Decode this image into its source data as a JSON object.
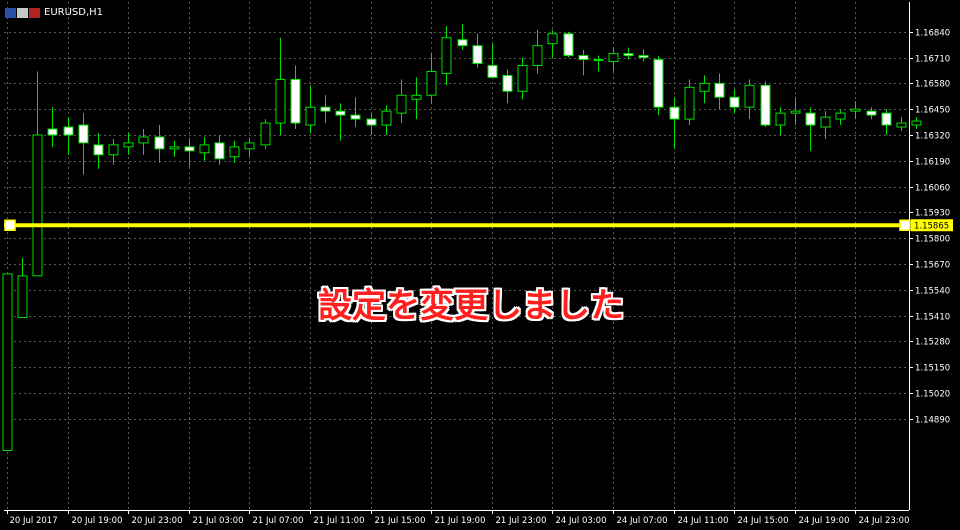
{
  "window": {
    "symbol_label": "EURUSD,H1"
  },
  "overlay_text": "設定を変更しました",
  "colors": {
    "background": "#000000",
    "grid": "#5a5a5a",
    "axis": "#ffffff",
    "bull_outline": "#00e000",
    "bear_fill": "#ffffff",
    "line": "#ffff00"
  },
  "chart_data": {
    "type": "candlestick",
    "symbol": "EURUSD",
    "timeframe": "H1",
    "ylim": [
      1.1443,
      1.1699
    ],
    "y_ticks": [
      "1.16840",
      "1.16710",
      "1.16580",
      "1.16450",
      "1.16320",
      "1.16190",
      "1.16060",
      "1.15930",
      "1.15800",
      "1.15670",
      "1.15540",
      "1.15410",
      "1.15280",
      "1.15150",
      "1.15020",
      "1.14890"
    ],
    "x_ticks": [
      "20 Jul 2017",
      "20 Jul 19:00",
      "20 Jul 23:00",
      "21 Jul 03:00",
      "21 Jul 07:00",
      "21 Jul 11:00",
      "21 Jul 15:00",
      "21 Jul 19:00",
      "21 Jul 23:00",
      "24 Jul 03:00",
      "24 Jul 07:00",
      "24 Jul 11:00",
      "24 Jul 15:00",
      "24 Jul 19:00",
      "24 Jul 23:00"
    ],
    "horizontal_line": {
      "price": 1.15865,
      "label": "1.15865"
    },
    "grid": true,
    "candles": [
      {
        "o": 1.1473,
        "h": 1.1562,
        "l": 1.1473,
        "c": 1.1562
      },
      {
        "o": 1.154,
        "h": 1.157,
        "l": 1.154,
        "c": 1.1561
      },
      {
        "o": 1.1561,
        "h": 1.1664,
        "l": 1.1561,
        "c": 1.1632
      },
      {
        "o": 1.1635,
        "h": 1.1646,
        "l": 1.1626,
        "c": 1.1632
      },
      {
        "o": 1.1636,
        "h": 1.1641,
        "l": 1.1622,
        "c": 1.1632
      },
      {
        "o": 1.1637,
        "h": 1.1643,
        "l": 1.1612,
        "c": 1.1628
      },
      {
        "o": 1.1627,
        "h": 1.1633,
        "l": 1.1615,
        "c": 1.1622
      },
      {
        "o": 1.1622,
        "h": 1.163,
        "l": 1.1617,
        "c": 1.1627
      },
      {
        "o": 1.1626,
        "h": 1.1633,
        "l": 1.1622,
        "c": 1.1628
      },
      {
        "o": 1.1628,
        "h": 1.1635,
        "l": 1.1622,
        "c": 1.1631
      },
      {
        "o": 1.1631,
        "h": 1.1637,
        "l": 1.1618,
        "c": 1.1625
      },
      {
        "o": 1.1625,
        "h": 1.1629,
        "l": 1.1621,
        "c": 1.1626
      },
      {
        "o": 1.1626,
        "h": 1.163,
        "l": 1.1616,
        "c": 1.1624
      },
      {
        "o": 1.1623,
        "h": 1.1631,
        "l": 1.1619,
        "c": 1.1627
      },
      {
        "o": 1.1628,
        "h": 1.1632,
        "l": 1.1617,
        "c": 1.162
      },
      {
        "o": 1.1621,
        "h": 1.1629,
        "l": 1.1618,
        "c": 1.1626
      },
      {
        "o": 1.1625,
        "h": 1.163,
        "l": 1.1621,
        "c": 1.1628
      },
      {
        "o": 1.1627,
        "h": 1.164,
        "l": 1.1625,
        "c": 1.1638
      },
      {
        "o": 1.1638,
        "h": 1.1681,
        "l": 1.1632,
        "c": 1.166
      },
      {
        "o": 1.166,
        "h": 1.1667,
        "l": 1.1635,
        "c": 1.1638
      },
      {
        "o": 1.1637,
        "h": 1.1657,
        "l": 1.1633,
        "c": 1.1646
      },
      {
        "o": 1.1646,
        "h": 1.1652,
        "l": 1.1638,
        "c": 1.1644
      },
      {
        "o": 1.1644,
        "h": 1.1648,
        "l": 1.1629,
        "c": 1.1642
      },
      {
        "o": 1.1642,
        "h": 1.1651,
        "l": 1.1636,
        "c": 1.164
      },
      {
        "o": 1.164,
        "h": 1.1643,
        "l": 1.1632,
        "c": 1.1637
      },
      {
        "o": 1.1637,
        "h": 1.1647,
        "l": 1.1632,
        "c": 1.1644
      },
      {
        "o": 1.1643,
        "h": 1.166,
        "l": 1.1638,
        "c": 1.1652
      },
      {
        "o": 1.165,
        "h": 1.1661,
        "l": 1.164,
        "c": 1.1652
      },
      {
        "o": 1.1652,
        "h": 1.1673,
        "l": 1.1648,
        "c": 1.1664
      },
      {
        "o": 1.1663,
        "h": 1.1687,
        "l": 1.1657,
        "c": 1.1681
      },
      {
        "o": 1.168,
        "h": 1.1688,
        "l": 1.1675,
        "c": 1.1677
      },
      {
        "o": 1.1677,
        "h": 1.1683,
        "l": 1.1666,
        "c": 1.1668
      },
      {
        "o": 1.1667,
        "h": 1.1678,
        "l": 1.1662,
        "c": 1.1661
      },
      {
        "o": 1.1662,
        "h": 1.1665,
        "l": 1.1648,
        "c": 1.1654
      },
      {
        "o": 1.1654,
        "h": 1.1671,
        "l": 1.165,
        "c": 1.1667
      },
      {
        "o": 1.1667,
        "h": 1.1685,
        "l": 1.1663,
        "c": 1.1677
      },
      {
        "o": 1.1678,
        "h": 1.1685,
        "l": 1.1671,
        "c": 1.1683
      },
      {
        "o": 1.1683,
        "h": 1.1684,
        "l": 1.1671,
        "c": 1.1672
      },
      {
        "o": 1.1672,
        "h": 1.1675,
        "l": 1.1662,
        "c": 1.167
      },
      {
        "o": 1.167,
        "h": 1.1672,
        "l": 1.1664,
        "c": 1.167
      },
      {
        "o": 1.1669,
        "h": 1.1676,
        "l": 1.1664,
        "c": 1.1673
      },
      {
        "o": 1.1673,
        "h": 1.1676,
        "l": 1.167,
        "c": 1.1672
      },
      {
        "o": 1.1672,
        "h": 1.1675,
        "l": 1.1669,
        "c": 1.1671
      },
      {
        "o": 1.167,
        "h": 1.1672,
        "l": 1.1642,
        "c": 1.1646
      },
      {
        "o": 1.1646,
        "h": 1.1651,
        "l": 1.1625,
        "c": 1.164
      },
      {
        "o": 1.164,
        "h": 1.166,
        "l": 1.1637,
        "c": 1.1656
      },
      {
        "o": 1.1654,
        "h": 1.1662,
        "l": 1.1648,
        "c": 1.1658
      },
      {
        "o": 1.1658,
        "h": 1.1663,
        "l": 1.1645,
        "c": 1.1651
      },
      {
        "o": 1.1651,
        "h": 1.1655,
        "l": 1.1643,
        "c": 1.1646
      },
      {
        "o": 1.1646,
        "h": 1.166,
        "l": 1.164,
        "c": 1.1657
      },
      {
        "o": 1.1657,
        "h": 1.1659,
        "l": 1.1636,
        "c": 1.1637
      },
      {
        "o": 1.1637,
        "h": 1.1646,
        "l": 1.1632,
        "c": 1.1643
      },
      {
        "o": 1.1643,
        "h": 1.1651,
        "l": 1.1637,
        "c": 1.1644
      },
      {
        "o": 1.1643,
        "h": 1.1646,
        "l": 1.1624,
        "c": 1.1637
      },
      {
        "o": 1.1636,
        "h": 1.1644,
        "l": 1.163,
        "c": 1.1641
      },
      {
        "o": 1.164,
        "h": 1.1645,
        "l": 1.1637,
        "c": 1.1643
      },
      {
        "o": 1.1644,
        "h": 1.1649,
        "l": 1.164,
        "c": 1.1645
      },
      {
        "o": 1.1644,
        "h": 1.1646,
        "l": 1.164,
        "c": 1.1642
      },
      {
        "o": 1.1643,
        "h": 1.1645,
        "l": 1.1632,
        "c": 1.1637
      },
      {
        "o": 1.1636,
        "h": 1.1641,
        "l": 1.1634,
        "c": 1.1638
      },
      {
        "o": 1.1637,
        "h": 1.1641,
        "l": 1.1635,
        "c": 1.1639
      }
    ]
  }
}
